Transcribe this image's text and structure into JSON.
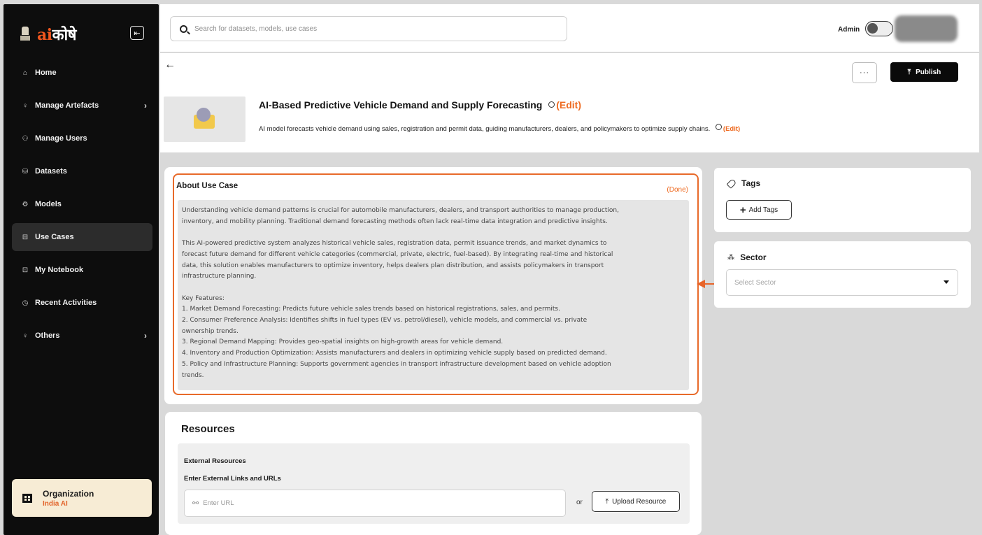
{
  "app": {
    "logo_ai": "ai",
    "logo_rest": "कोषे"
  },
  "sidebar": {
    "items": [
      {
        "label": "Home",
        "icon": "home-icon",
        "glyph": "⌂",
        "chevron": ""
      },
      {
        "label": "Manage Artefacts",
        "icon": "bulb-icon",
        "glyph": "♀",
        "chevron": "›"
      },
      {
        "label": "Manage Users",
        "icon": "users-icon",
        "glyph": "⚇",
        "chevron": ""
      },
      {
        "label": "Datasets",
        "icon": "database-icon",
        "glyph": "⛁",
        "chevron": ""
      },
      {
        "label": "Models",
        "icon": "model-icon",
        "glyph": "⚙",
        "chevron": ""
      },
      {
        "label": "Use Cases",
        "icon": "briefcase-icon",
        "glyph": "⊟",
        "chevron": ""
      },
      {
        "label": "My Notebook",
        "icon": "notebook-icon",
        "glyph": "⊡",
        "chevron": ""
      },
      {
        "label": "Recent Activities",
        "icon": "clock-icon",
        "glyph": "◷",
        "chevron": ""
      },
      {
        "label": "Others",
        "icon": "bulb-icon",
        "glyph": "♀",
        "chevron": "›"
      }
    ],
    "active_index": 5,
    "org": {
      "title": "Organization",
      "name": "India AI"
    }
  },
  "topbar": {
    "search_placeholder": "Search for datasets, models, use cases",
    "role_label": "Admin"
  },
  "header": {
    "more_label": "···",
    "publish_label": "Publish",
    "title": "AI-Based Predictive Vehicle Demand and Supply Forecasting",
    "edit_label": "(Edit)",
    "description": "AI model forecasts vehicle demand using sales, registration and permit data, guiding manufacturers, dealers, and policymakers to optimize supply chains."
  },
  "about": {
    "title": "About Use Case",
    "done_label": "(Done)",
    "text": "Understanding vehicle demand patterns is crucial for automobile manufacturers, dealers, and transport authorities to manage production,\ninventory, and mobility planning. Traditional demand forecasting methods often lack real-time data integration and predictive insights.\n\nThis AI-powered predictive system analyzes historical vehicle sales, registration data, permit issuance trends, and market dynamics to\nforecast future demand for different vehicle categories (commercial, private, electric, fuel-based). By integrating real-time and historical\ndata, this solution enables manufacturers to optimize inventory, helps dealers plan distribution, and assists policymakers in transport\ninfrastructure planning.\n\nKey Features:\n1. Market Demand Forecasting: Predicts future vehicle sales trends based on historical registrations, sales, and permits.\n2. Consumer Preference Analysis: Identifies shifts in fuel types (EV vs. petrol/diesel), vehicle models, and commercial vs. private\nownership trends.\n3. Regional Demand Mapping: Provides geo-spatial insights on high-growth areas for vehicle demand.\n4. Inventory and Production Optimization: Assists manufacturers and dealers in optimizing vehicle supply based on predicted demand.\n5. Policy and Infrastructure Planning: Supports government agencies in transport infrastructure development based on vehicle adoption\ntrends."
  },
  "tags": {
    "title": "Tags",
    "add_label": "Add Tags"
  },
  "sector": {
    "title": "Sector",
    "placeholder": "Select Sector"
  },
  "resources": {
    "title": "Resources",
    "external_title": "External Resources",
    "external_sub": "Enter External Links and URLs",
    "url_placeholder": "Enter URL",
    "or_label": "or",
    "upload_label": "Upload Resource"
  },
  "colors": {
    "accent": "#EE6A20",
    "sidebar_bg": "#0D0D0D",
    "org_bg": "#F7ECD5"
  }
}
